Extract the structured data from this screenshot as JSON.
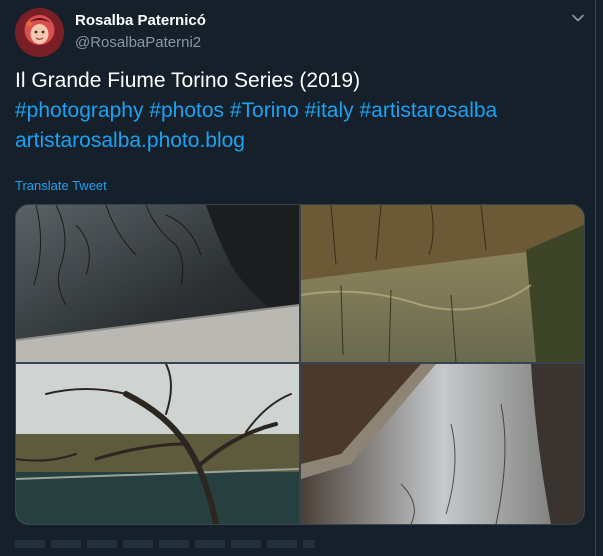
{
  "tweet": {
    "display_name": "Rosalba Paternicó",
    "handle": "@RosalbaPaterni2",
    "text_line1": "Il Grande Fiume Torino Series (2019)",
    "hashtags": [
      "#photography",
      "#photos",
      "#Torino",
      "#italy",
      "#artistarosalba"
    ],
    "link": "artistarosalba.photo.blog",
    "translate_label": "Translate Tweet"
  },
  "icons": {
    "menu": "chevron-down-icon",
    "avatar": "avatar"
  },
  "colors": {
    "background": "#15202b",
    "accent": "#1da1f2",
    "secondary_text": "#8899a6",
    "border": "#38444d"
  },
  "media": {
    "photos": [
      {
        "alt": "photo-1"
      },
      {
        "alt": "photo-2"
      },
      {
        "alt": "photo-3"
      },
      {
        "alt": "photo-4"
      }
    ]
  }
}
